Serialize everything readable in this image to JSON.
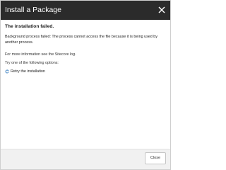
{
  "dialog": {
    "title": "Install a Package",
    "close_icon": "close-icon"
  },
  "content": {
    "heading": "The installation failed.",
    "error": "Background process failed: The process cannot access the file because it is being used by another process.",
    "info": "For more information see the Sitecore log.",
    "options_intro": "Try one of the following options:",
    "retry": {
      "icon": "refresh-icon",
      "label": "Retry the installation"
    }
  },
  "footer": {
    "close_label": "Close"
  },
  "colors": {
    "titlebar": "#2b2b2b",
    "footer": "#f1f1f1",
    "retry_icon": "#3a7fc1"
  }
}
